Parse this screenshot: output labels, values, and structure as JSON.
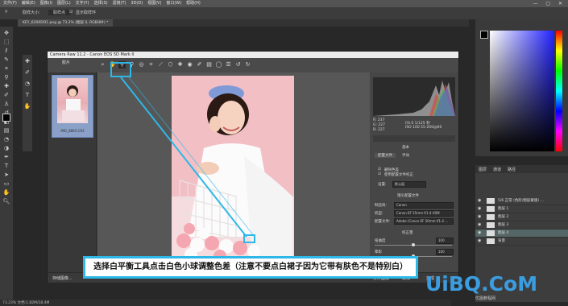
{
  "menubar": {
    "items": [
      "文件(F)",
      "编辑(E)",
      "图像(I)",
      "图层(L)",
      "文字(Y)",
      "选择(S)",
      "滤镜(T)",
      "3D(D)",
      "视图(V)",
      "窗口(W)",
      "帮助(H)"
    ],
    "window_controls": "— ▢ ✕"
  },
  "options": {
    "sample": "取样大小:",
    "sample_value": "取样点",
    "show_ring": "显示取样环"
  },
  "document_tab": "KEY_6200DO1.png @ 73.2% (图层 0, RGB/8#) *",
  "acr": {
    "title": "Camera Raw 11.2 - Canon EOS 5D Mark II",
    "filmstrip_label": "胶片",
    "thumb_name": "IMG_8865.CR2",
    "rgb_readout": {
      "r": "R: 237",
      "g": "G: 227",
      "b": "B: 227",
      "exposure": "f/4.0  1/125 秒",
      "iso": "ISO 100  55-200@60"
    },
    "panel_section": "基本",
    "tabs": [
      "配置文件",
      "手动"
    ],
    "checkboxes": [
      "启用镜头校正",
      "删除色差",
      "使用配置文件校正"
    ],
    "setup_label": "设置:",
    "setup_value": "默认值",
    "profile_header": "镜头配置文件",
    "make_label": "制造商:",
    "make_value": "Canon",
    "model_label": "机型:",
    "model_value": "Canon EF 55mm f/1.4 USM",
    "profile_label": "配置文件:",
    "profile_value": "Adobe (Canon EF 50mm f/1.4 ...",
    "amount_header": "校正量",
    "distortion_label": "扭曲度",
    "distortion_value": "100",
    "vignette_label": "晕影",
    "vignette_value": "100",
    "bottom_left": "存储图像...",
    "bottom_right": [
      "打开图像",
      "取消",
      "完成"
    ]
  },
  "callout": "选择白平衡工具点击白色小球调整色差（注意不要点白裙子因为它带有肤色不是特别白）",
  "layers": {
    "tabs": [
      "图层",
      "通道",
      "路径"
    ],
    "items": [
      "5/6 正常 (色阶/图层蒙版) ...",
      "图层 1",
      "图层 2",
      "图层 3",
      "图层 4",
      "背景"
    ]
  },
  "status": "73.23%    文档:1.82M/18.4M",
  "watermark": "UiBQ.CoM",
  "watermark_sub": "优图教程网"
}
